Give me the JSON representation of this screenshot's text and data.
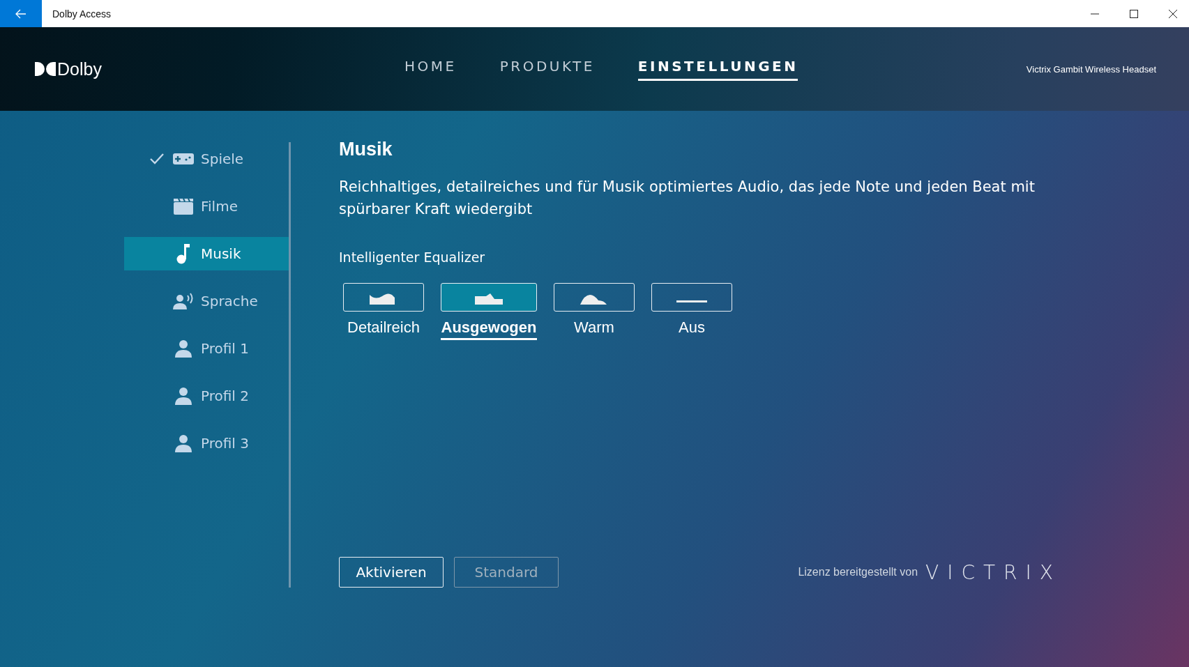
{
  "window": {
    "title": "Dolby Access"
  },
  "header": {
    "logo": "Dolby",
    "nav": [
      {
        "label": "HOME",
        "selected": false
      },
      {
        "label": "PRODUKTE",
        "selected": false
      },
      {
        "label": "EINSTELLUNGEN",
        "selected": true
      }
    ],
    "device": "Victrix Gambit Wireless Headset"
  },
  "sidebar": {
    "items": [
      {
        "kind": "gamepad",
        "label": "Spiele",
        "checked": true,
        "selected": false
      },
      {
        "kind": "clapper",
        "label": "Filme",
        "checked": false,
        "selected": false
      },
      {
        "kind": "note",
        "label": "Musik",
        "checked": false,
        "selected": true
      },
      {
        "kind": "voice",
        "label": "Sprache",
        "checked": false,
        "selected": false
      },
      {
        "kind": "person",
        "label": "Profil 1",
        "checked": false,
        "selected": false
      },
      {
        "kind": "person",
        "label": "Profil 2",
        "checked": false,
        "selected": false
      },
      {
        "kind": "person",
        "label": "Profil 3",
        "checked": false,
        "selected": false
      }
    ]
  },
  "content": {
    "title": "Musik",
    "description": "Reichhaltiges, detailreiches und für Musik optimiertes Audio, das jede Note und jeden Beat mit spürbarer Kraft wiedergibt",
    "equalizer_label": "Intelligenter Equalizer",
    "equalizer": [
      {
        "kind": "detailed",
        "label": "Detailreich",
        "selected": false
      },
      {
        "kind": "balanced",
        "label": "Ausgewogen",
        "selected": true
      },
      {
        "kind": "warm",
        "label": "Warm",
        "selected": false
      },
      {
        "kind": "flat",
        "label": "Aus",
        "selected": false
      }
    ],
    "buttons": [
      {
        "label": "Aktivieren",
        "disabled": false
      },
      {
        "label": "Standard",
        "disabled": true
      }
    ],
    "license": "Lizenz bereitgestellt von",
    "license_logo": "VICTRIX"
  }
}
